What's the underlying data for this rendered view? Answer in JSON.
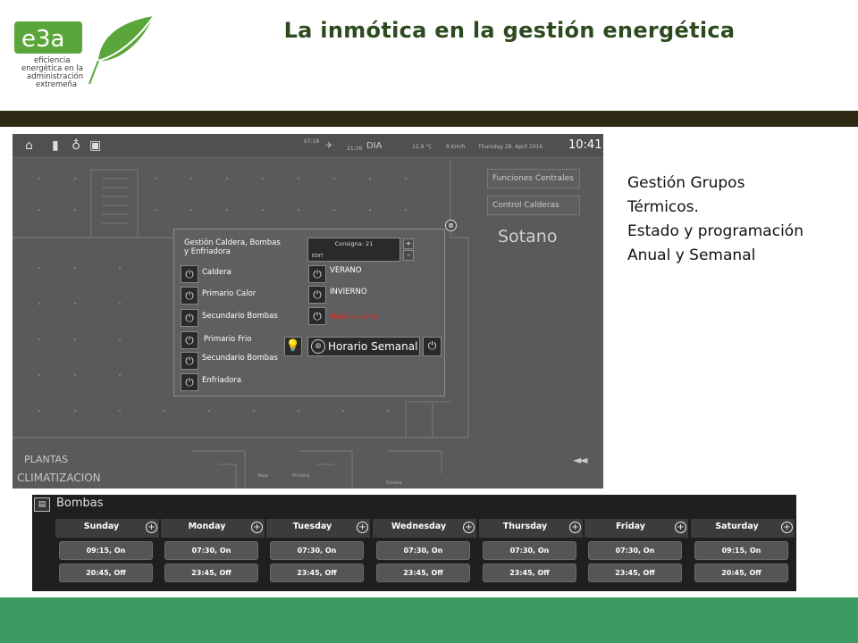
{
  "header": {
    "title": "La inmótica en la gestión energética",
    "logo_text": "e3a",
    "logo_subtext": [
      "eficiencia",
      "energética en la",
      "administración",
      "extremeña"
    ]
  },
  "side_text": [
    "Gestión Grupos",
    "Térmicos.",
    "Estado y programación",
    "Anual y Semanal"
  ],
  "hmi": {
    "time_a": "07:18",
    "time_b": "21:26",
    "mode": "DIA",
    "temperature": "11.9 °C",
    "wind": "9 Km/h",
    "date": "Thursday 28. April 2016",
    "clock": "10:41",
    "btn_funciones": "Funciones Centrales",
    "btn_calderas": "Control Calderas",
    "area": "Sotano",
    "plantas": "PLANTAS",
    "climatizacion": "CLIMATIZACION",
    "rewind": "◄◄",
    "floor_labels": [
      "Baja",
      "Primera",
      "Sotano"
    ],
    "dialog": {
      "title_line1": "Gestión  Caldera, Bombas",
      "title_line2": " y Enfriadora",
      "close": "⊗",
      "items": [
        "Caldera",
        "Primario Calor",
        "Secundario Bombas",
        "Primario Frio",
        "Secundario Bombas",
        "Enfriadora"
      ],
      "consigna": "Consigna: 21",
      "edit": "EDIT",
      "plus": "+",
      "minus": "–",
      "modes": [
        "VERANO",
        "INVIERNO",
        "Modo Invierno"
      ],
      "horario": "Horario Semanal"
    }
  },
  "scheduler": {
    "title": "Bombas",
    "days": [
      {
        "name": "Sunday",
        "slots": [
          "09:15, On",
          "20:45, Off"
        ]
      },
      {
        "name": "Monday",
        "slots": [
          "07:30, On",
          "23:45, Off"
        ]
      },
      {
        "name": "Tuesday",
        "slots": [
          "07:30, On",
          "23:45, Off"
        ]
      },
      {
        "name": "Wednesday",
        "slots": [
          "07:30, On",
          "23:45, Off"
        ]
      },
      {
        "name": "Thursday",
        "slots": [
          "07:30, On",
          "23:45, Off"
        ]
      },
      {
        "name": "Friday",
        "slots": [
          "07:30, On",
          "23:45, Off"
        ]
      },
      {
        "name": "Saturday",
        "slots": [
          "09:15, On",
          "20:45, Off"
        ]
      }
    ]
  },
  "colors": {
    "title_green": "#2d4a1e",
    "dark_band": "#2f2a16",
    "bottom_band": "#3a9a5f",
    "logo_green": "#5aa63a",
    "mode_red": "#e02020"
  }
}
